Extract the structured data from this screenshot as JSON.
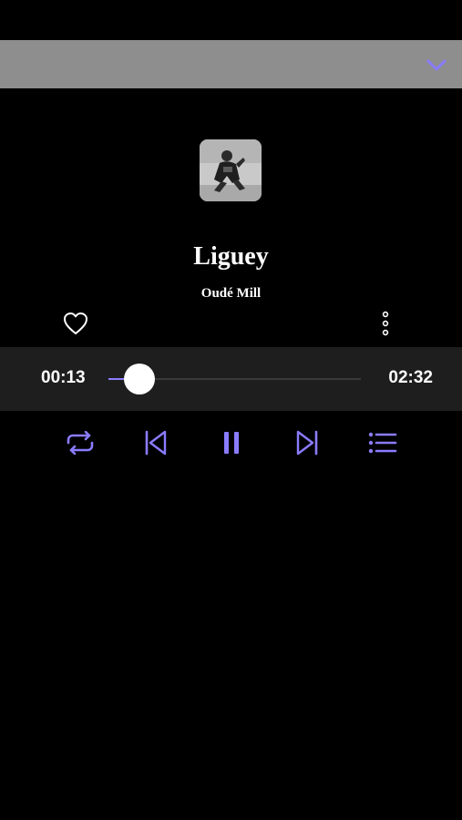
{
  "header": {
    "collapse_icon": "chevron-down-icon"
  },
  "track": {
    "title": "Liguey",
    "artist": "Oudé Mill",
    "cover_icon": "album-art-image",
    "liked": false
  },
  "progress": {
    "elapsed": "00:13",
    "total": "02:32",
    "fraction": 0.09
  },
  "controls": {
    "repeat_icon": "repeat-icon",
    "previous_icon": "skip-previous-icon",
    "play_state_icon": "pause-icon",
    "next_icon": "skip-next-icon",
    "queue_icon": "queue-list-icon"
  },
  "colors": {
    "accent": "#8a7cff",
    "background": "#000000",
    "header_bar": "#8e8e8e",
    "panel": "#1e1e1e",
    "text": "#ffffff"
  }
}
